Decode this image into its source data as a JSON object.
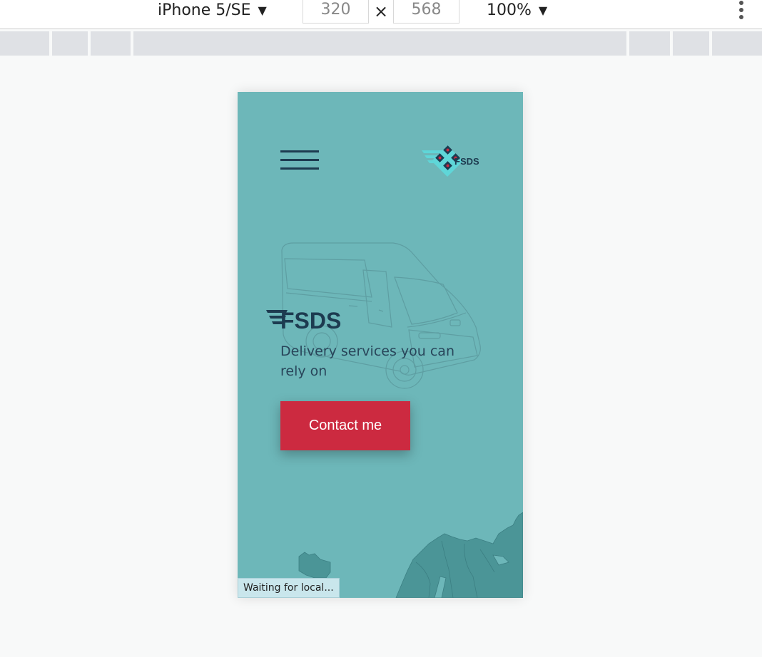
{
  "toolbar": {
    "device": "iPhone 5/SE",
    "width": "320",
    "height": "568",
    "separator": "×",
    "zoom": "100%"
  },
  "viewport": {
    "brand": "FSDS",
    "logo_text": "FSDS",
    "tagline": "Delivery services you can rely on",
    "cta_label": "Contact me",
    "status_text": "Waiting for local...",
    "colors": {
      "background": "#6db7b9",
      "dark": "#1d3b50",
      "accent": "#cc2a40"
    }
  }
}
